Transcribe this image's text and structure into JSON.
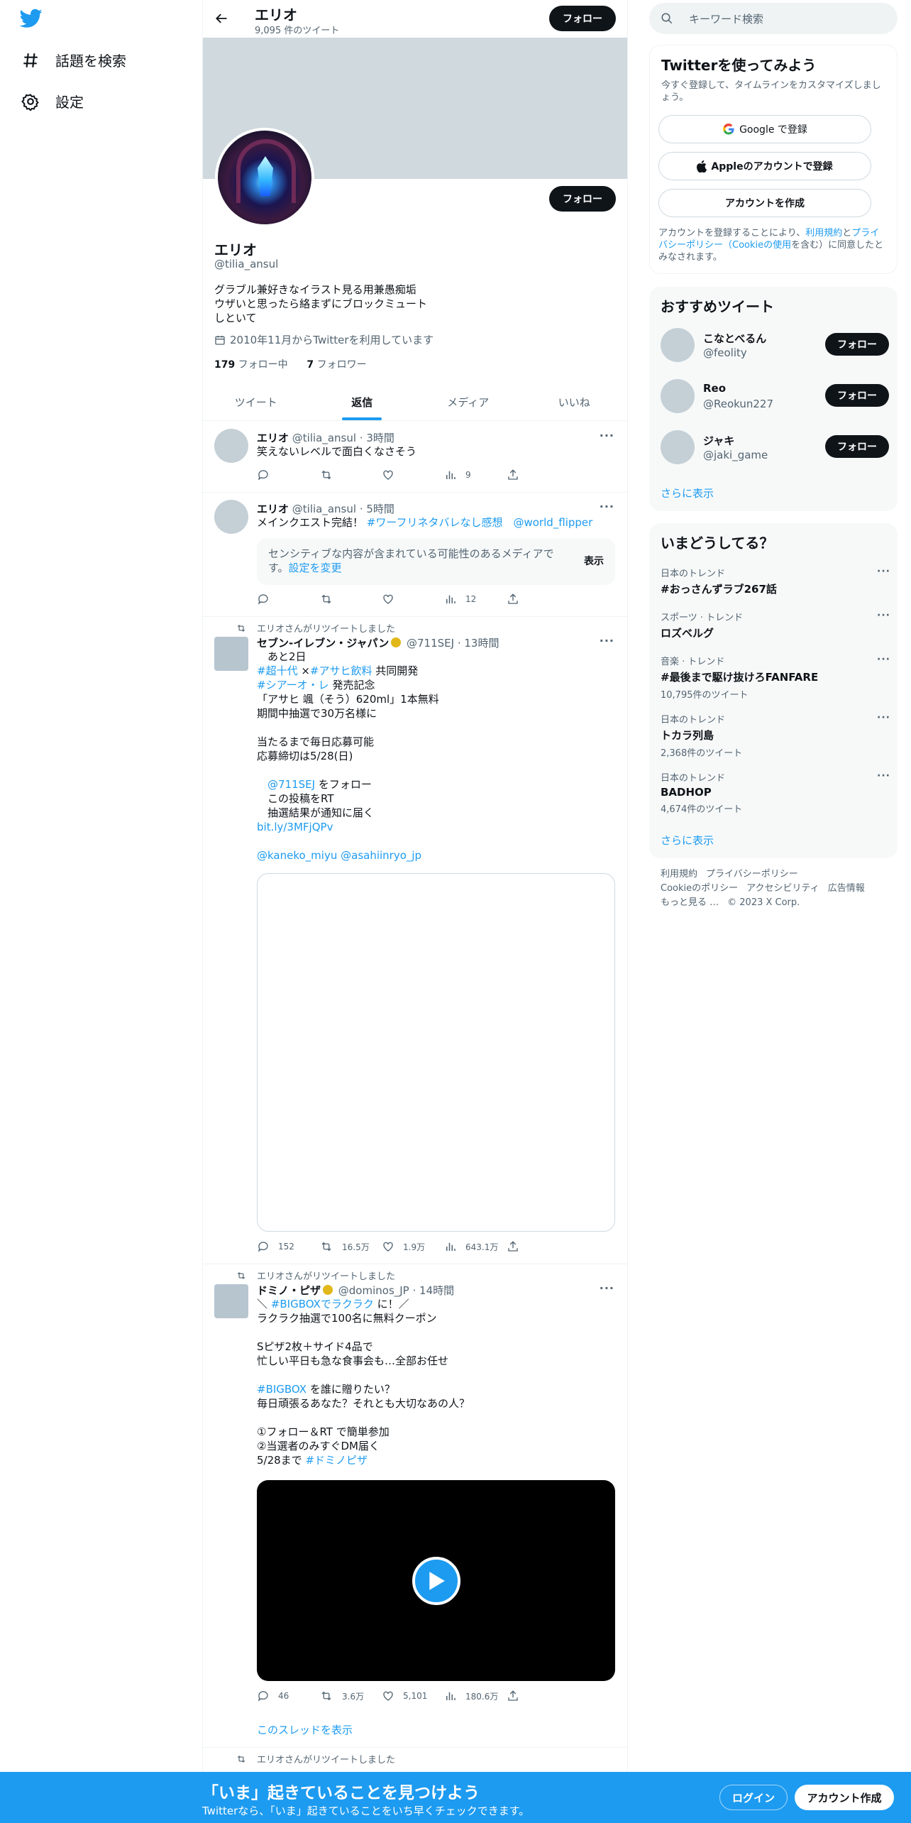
{
  "nav": {
    "explore_label": "話題を検索",
    "settings_label": "設定"
  },
  "header": {
    "name": "エリオ",
    "tweet_count": "9,095 件のツイート",
    "follow_label": "フォロー"
  },
  "profile": {
    "name": "エリオ",
    "handle": "@tilia_ansul",
    "bio": "グラブル兼好きなイラスト見る用兼愚痴垢\nウザいと思ったら絡まずにブロックミュートしといて",
    "joined": "2010年11月からTwitterを利用しています",
    "following_count": "179",
    "following_label": " フォロー中",
    "followers_count": "7",
    "followers_label": " フォロワー",
    "follow_label": "フォロー"
  },
  "tabs": [
    "ツイート",
    "返信",
    "メディア",
    "いいね"
  ],
  "tweets": [
    {
      "name": "エリオ",
      "meta": " @tilia_ansul · 3時間",
      "text": "笑えないレベルで面白くなさそう",
      "views": "9"
    },
    {
      "name": "エリオ",
      "meta": " @tilia_ansul · 5時間",
      "text_prefix": "メインクエスト完結！ ",
      "hashtag": "#ワーフリネタバレなし感想",
      "mention": "@world_flipper",
      "sensitive_text": "センシティブな内容が含まれている可能性のあるメディアです。",
      "sensitive_link": "設定を変更",
      "sensitive_show": "表示",
      "views": "12"
    },
    {
      "retweet_label": "エリオさんがリツイートしました",
      "name": "セブン‐イレブン・ジャパン",
      "meta": " @711SEJ · 13時間",
      "line1": "　あと2日",
      "tag1": "#超十代",
      "sep": " ×",
      "tag2": "#アサヒ飲料",
      "line2_rest": " 共同開発",
      "tag3": "#シアーオ・レ",
      "line3_rest": " 発売記念",
      "body": "「アサヒ 颯（そう）620ml」1本無料\n期間中抽選で30万名様に\n\n当たるまで毎日応募可能\n応募締切は5/28(日)",
      "mention1": "@711SEJ",
      "step1_rest": " をフォロー",
      "step2": "　この投稿をRT",
      "step3": "　抽選結果が通知に届く",
      "link": "bit.ly/3MFjQPv",
      "mention2": "@kaneko_miyu",
      "mention3": "@asahiinryo_jp",
      "replies": "152",
      "retweets": "16.5万",
      "likes": "1.9万",
      "views": "643.1万"
    },
    {
      "retweet_label": "エリオさんがリツイートしました",
      "name": "ドミノ・ピザ",
      "meta": " @dominos_JP · 14時間",
      "line1_prefix": "＼ ",
      "tag1": "#BIGBOXでラクラク",
      "line1_suffix": " に！／",
      "body1": "ラクラク抽選で100名に無料クーポン\n\nSピザ2枚＋サイド4品で\n忙しい平日も急な食事会も…全部お任せ",
      "tag2": "#BIGBOX",
      "line_after_tag2": " を誰に贈りたい？",
      "body2": "毎日頑張るあなた？それとも大切なあの人？\n\n①フォロー＆RT で簡単参加\n②当選者のみすぐDM届く",
      "line_last_prefix": "5/28まで ",
      "tag3": "#ドミノピザ",
      "replies": "46",
      "retweets": "3.6万",
      "likes": "5,101",
      "views": "180.6万",
      "show_thread": "このスレッドを表示"
    },
    {
      "retweet_label": "エリオさんがリツイートしました"
    }
  ],
  "right": {
    "search_placeholder": "キーワード検索",
    "signup": {
      "title": "Twitterを使ってみよう",
      "subtitle": "今すぐ登録して、タイムラインをカスタマイズしましょう。",
      "google": "Google で登録",
      "apple": "Appleのアカウントで登録",
      "create": "アカウントを作成",
      "legal_prefix": "アカウントを登録することにより、",
      "legal_terms": "利用規約",
      "legal_and": "と",
      "legal_privacy": "プライバシーポリシー（Cookieの使用",
      "legal_suffix": "を含む）に同意したとみなされます。"
    },
    "recommend": {
      "title": "おすすめツイート",
      "users": [
        {
          "name": "こなとべるん",
          "handle": "@feolity"
        },
        {
          "name": "Reo",
          "handle": "@Reokun227"
        },
        {
          "name": "ジャキ",
          "handle": "@jaki_game"
        }
      ],
      "follow_label": "フォロー",
      "more": "さらに表示"
    },
    "trends": {
      "title": "いまどうしてる？",
      "items": [
        {
          "context": "日本のトレンド",
          "name": "#おっさんずラブ267話",
          "count": ""
        },
        {
          "context": "スポーツ · トレンド",
          "name": "ロズベルグ",
          "count": ""
        },
        {
          "context": "音楽 · トレンド",
          "name": "#最後まで駆け抜けろFANFARE",
          "count": "10,795件のツイート"
        },
        {
          "context": "日本のトレンド",
          "name": "トカラ列島",
          "count": "2,368件のツイート"
        },
        {
          "context": "日本のトレンド",
          "name": "BADHOP",
          "count": "4,674件のツイート"
        }
      ],
      "more": "さらに表示"
    },
    "footer": [
      "利用規約",
      "プライバシーポリシー",
      "Cookieのポリシー",
      "アクセシビリティ",
      "広告情報",
      "もっと見る …",
      "© 2023 X Corp."
    ]
  },
  "bottombar": {
    "title": "「いま」起きていることを見つけよう",
    "subtitle": "Twitterなら、「いま」起きていることをいち早くチェックできます。",
    "login": "ログイン",
    "signup": "アカウント作成"
  },
  "colors": {
    "accent": "#1d9bf0",
    "dark": "#0f1419",
    "muted": "#536471"
  }
}
